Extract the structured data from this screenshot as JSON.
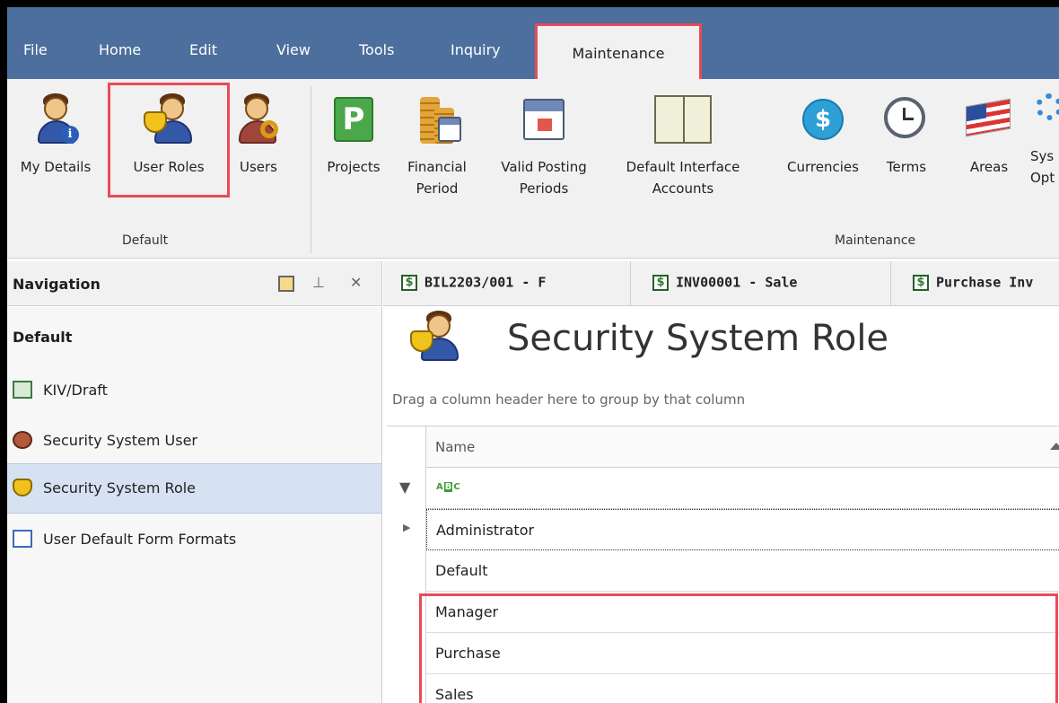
{
  "menubar": {
    "items": [
      "File",
      "Home",
      "Edit",
      "View",
      "Tools",
      "Inquiry"
    ],
    "active": "Maintenance"
  },
  "ribbon": {
    "default_group": {
      "label": "Default",
      "buttons": [
        {
          "label": "My Details",
          "icon": "user-info-icon"
        },
        {
          "label": "User Roles",
          "icon": "user-mask-icon"
        },
        {
          "label": "Users",
          "icon": "user-key-icon"
        }
      ]
    },
    "maintenance_group": {
      "label": "Maintenance",
      "buttons": [
        {
          "label": "Projects",
          "icon": "projects-icon"
        },
        {
          "label": "Financial",
          "label2": "Period",
          "icon": "coins-calendar-icon"
        },
        {
          "label": "Valid Posting",
          "label2": "Periods",
          "icon": "calendar-icon"
        },
        {
          "label": "Default Interface",
          "label2": "Accounts",
          "icon": "ledger-book-icon"
        },
        {
          "label": "Currencies",
          "icon": "dollar-coin-icon"
        },
        {
          "label": "Terms",
          "icon": "alarm-clock-icon"
        },
        {
          "label": "Areas",
          "icon": "flag-icon"
        },
        {
          "label": "Sys",
          "label2": "Opt",
          "icon": "gear-icon"
        }
      ]
    }
  },
  "navigation": {
    "title": "Navigation",
    "group": "Default",
    "items": [
      {
        "label": "KIV/Draft",
        "icon": "kiv-draft-icon"
      },
      {
        "label": "Security System User",
        "icon": "security-user-icon"
      },
      {
        "label": "Security System Role",
        "icon": "security-role-icon",
        "selected": true
      },
      {
        "label": "User Default Form Formats",
        "icon": "form-format-icon"
      }
    ]
  },
  "tabs": [
    {
      "label": "BIL2203/001 - F"
    },
    {
      "label": "INV00001 - Sale"
    },
    {
      "label": "Purchase Inv"
    }
  ],
  "main": {
    "title": "Security System Role",
    "group_hint": "Drag a column header here to group by that column",
    "column": "Name",
    "filter_placeholder": "ABC",
    "rows": [
      "Administrator",
      "Default",
      "Manager",
      "Purchase",
      "Sales"
    ]
  },
  "colors": {
    "menubar": "#4c6f9d",
    "highlight": "#e84b58",
    "selected_nav": "#d6e2f2"
  }
}
